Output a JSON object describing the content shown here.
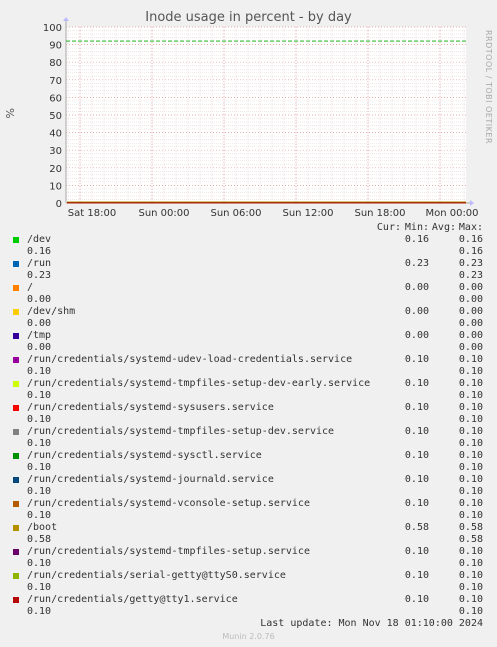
{
  "side_label": "RRDTOOL / TOBI OETIKER",
  "footer": {
    "last_update": "Last update: Mon Nov 18 01:10:00 2024",
    "munin_version": "Munin 2.0.76"
  },
  "legend_header": {
    "cur": "Cur:",
    "min": "Min:",
    "avg": "Avg:",
    "max": "Max:"
  },
  "chart_data": {
    "type": "line",
    "title": "Inode usage in percent - by day",
    "ylabel": "%",
    "ylim": [
      0,
      100
    ],
    "yticks": [
      "0",
      "10",
      "20",
      "30",
      "40",
      "50",
      "60",
      "70",
      "80",
      "90",
      "100"
    ],
    "xticks": [
      "Sat 18:00",
      "Sun 00:00",
      "Sun 06:00",
      "Sun 12:00",
      "Sun 18:00",
      "Mon 00:00"
    ],
    "warning_line": 92,
    "grid": true,
    "series": [
      {
        "name": "/dev",
        "color": "#00cc00",
        "cur": "0.16",
        "min": "0.16",
        "avg": "0.16",
        "max": "0.16"
      },
      {
        "name": "/run",
        "color": "#0066b3",
        "cur": "0.23",
        "min": "0.23",
        "avg": "0.23",
        "max": "0.23"
      },
      {
        "name": "/",
        "color": "#ff8000",
        "cur": "0.00",
        "min": "0.00",
        "avg": "0.00",
        "max": "0.00"
      },
      {
        "name": "/dev/shm",
        "color": "#ffcc00",
        "cur": "0.00",
        "min": "0.00",
        "avg": "0.00",
        "max": "0.00"
      },
      {
        "name": "/tmp",
        "color": "#330099",
        "cur": "0.00",
        "min": "0.00",
        "avg": "0.00",
        "max": "0.00"
      },
      {
        "name": "/run/credentials/systemd-udev-load-credentials.service",
        "color": "#990099",
        "cur": "0.10",
        "min": "0.10",
        "avg": "0.10",
        "max": "0.10"
      },
      {
        "name": "/run/credentials/systemd-tmpfiles-setup-dev-early.service",
        "color": "#ccff00",
        "cur": "0.10",
        "min": "0.10",
        "avg": "0.10",
        "max": "0.10"
      },
      {
        "name": "/run/credentials/systemd-sysusers.service",
        "color": "#ff0000",
        "cur": "0.10",
        "min": "0.10",
        "avg": "0.10",
        "max": "0.10"
      },
      {
        "name": "/run/credentials/systemd-tmpfiles-setup-dev.service",
        "color": "#808080",
        "cur": "0.10",
        "min": "0.10",
        "avg": "0.10",
        "max": "0.10"
      },
      {
        "name": "/run/credentials/systemd-sysctl.service",
        "color": "#008f00",
        "cur": "0.10",
        "min": "0.10",
        "avg": "0.10",
        "max": "0.10"
      },
      {
        "name": "/run/credentials/systemd-journald.service",
        "color": "#00487d",
        "cur": "0.10",
        "min": "0.10",
        "avg": "0.10",
        "max": "0.10"
      },
      {
        "name": "/run/credentials/systemd-vconsole-setup.service",
        "color": "#b35a00",
        "cur": "0.10",
        "min": "0.10",
        "avg": "0.10",
        "max": "0.10"
      },
      {
        "name": "/boot",
        "color": "#b38f00",
        "cur": "0.58",
        "min": "0.58",
        "avg": "0.58",
        "max": "0.58"
      },
      {
        "name": "/run/credentials/systemd-tmpfiles-setup.service",
        "color": "#6b006b",
        "cur": "0.10",
        "min": "0.10",
        "avg": "0.10",
        "max": "0.10"
      },
      {
        "name": "/run/credentials/serial-getty@ttyS0.service",
        "color": "#8fb300",
        "cur": "0.10",
        "min": "0.10",
        "avg": "0.10",
        "max": "0.10"
      },
      {
        "name": "/run/credentials/getty@tty1.service",
        "color": "#b30000",
        "cur": "0.10",
        "min": "0.10",
        "avg": "0.10",
        "max": "0.10"
      }
    ]
  }
}
